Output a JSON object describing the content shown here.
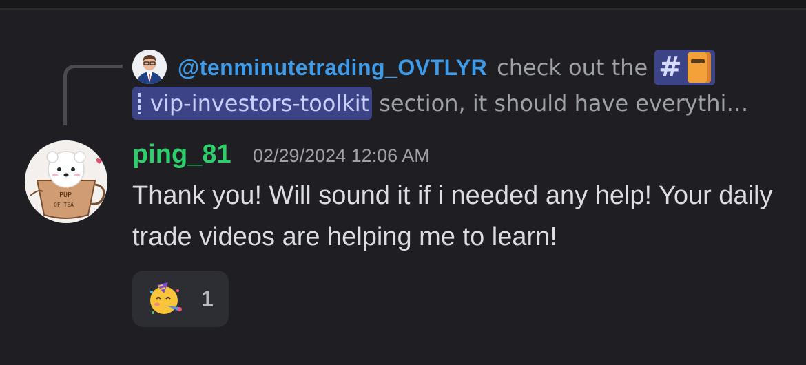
{
  "reply": {
    "mention": "@tenminutetrading_OVTLYR",
    "text_before_channel": "check out the",
    "channel_name": "vip-investors-toolkit",
    "text_after_channel": "section, it should have everythi…"
  },
  "message": {
    "username": "ping_81",
    "timestamp": "02/29/2024 12:06 AM",
    "body": "Thank you! Will sound it if i needed any help! Your daily trade videos are helping me to learn!"
  },
  "reaction": {
    "emoji_name": "partying-face",
    "count": "1"
  },
  "avatar_text": {
    "line1": "PUP",
    "line2": "OF TEA"
  },
  "colors": {
    "background": "#1f1f23",
    "mention": "#3d9be9",
    "username": "#2fce6c",
    "channel_pill": "#3d4387"
  }
}
